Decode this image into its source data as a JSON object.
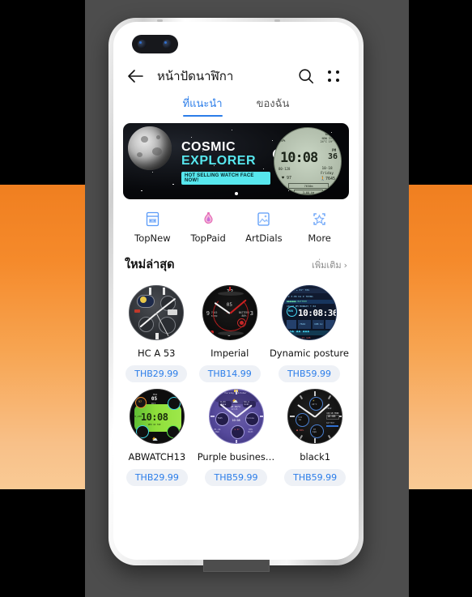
{
  "app": {
    "title": "หน้าปัดนาฬิกา",
    "back_icon": "back-arrow-icon",
    "search_icon": "search-icon",
    "menu_icon": "grid-dots-icon"
  },
  "tabs": [
    {
      "label": "ที่แนะนำ",
      "active": true
    },
    {
      "label": "ของฉัน",
      "active": false
    }
  ],
  "banner": {
    "line1": "COSMIC",
    "line2": "EXPLORER",
    "badge": "HOT SELLING WATCH FACE NOW!",
    "watch_preview": {
      "time": "10:08",
      "pm": "PM",
      "seconds": "36",
      "weather_title": "WEATHER",
      "weather_now": "NOW  31° ↑",
      "weather_temp": "24°C  19° ↓",
      "battery": "88%",
      "date": "10-18",
      "day": "Friday",
      "hr_range": "80-128",
      "hr": "97",
      "steps": "7645",
      "distance_label": "7630m",
      "distance": "3.66 km"
    },
    "carousel_dots": 1,
    "active_dot": 0
  },
  "categories": [
    {
      "label": "TopNew",
      "icon": "new-list-icon",
      "color": "#5b9bf8"
    },
    {
      "label": "TopPaid",
      "icon": "flame-icon",
      "color": "#e56bb5"
    },
    {
      "label": "ArtDials",
      "icon": "image-icon",
      "color": "#5b9bf8"
    },
    {
      "label": "More",
      "icon": "star-frame-icon",
      "color": "#5b9bf8"
    }
  ],
  "section": {
    "title": "ใหม่ล่าสุด",
    "more_label": "เพิ่มเติม",
    "more_chevron": "chevron-right-icon"
  },
  "watch_faces": [
    [
      {
        "name": "HC A 53",
        "price": "THB29.99",
        "style": "dial-hc",
        "time": ""
      },
      {
        "name": "Imperial",
        "price": "THB14.99",
        "style": "dial-imperial",
        "time": ""
      },
      {
        "name": "Dynamic posture",
        "price": "THB59.99",
        "style": "dial-dynamic",
        "time": "10:08:36"
      }
    ],
    [
      {
        "name": "ABWATCH13",
        "price": "THB29.99",
        "style": "dial-abwatch",
        "time": "10:08"
      },
      {
        "name": "Purple busines…",
        "price": "THB59.99",
        "style": "dial-purple",
        "time": ""
      },
      {
        "name": "black1",
        "price": "THB59.99",
        "style": "dial-black1",
        "time": "10:08"
      }
    ]
  ],
  "theme": {
    "accent": "#2b7de9",
    "price_bg": "#eef1f6",
    "banner_cyan": "#57e7ee",
    "bg_orange_top": "#f07f20",
    "bg_orange_bottom": "#f9ca95",
    "bg_gray": "#4d4d4d",
    "bg_black": "#000000"
  }
}
